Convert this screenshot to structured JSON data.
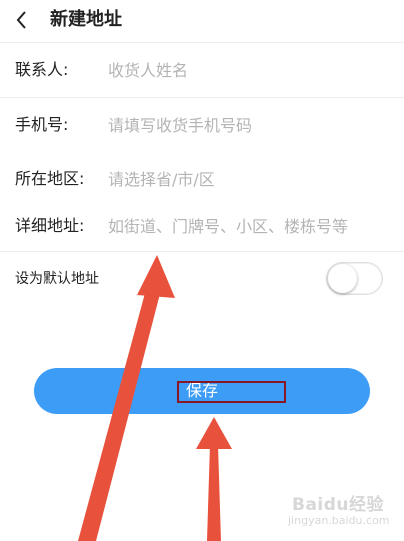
{
  "header": {
    "title": "新建地址",
    "back_icon": "chevron-left-icon"
  },
  "form": {
    "contact": {
      "label": "联系人:",
      "placeholder": "收货人姓名",
      "value": ""
    },
    "phone": {
      "label": "手机号:",
      "placeholder": "请填写收货手机号码",
      "value": ""
    },
    "region": {
      "label": "所在地区:",
      "placeholder": "请选择省/市/区",
      "value": ""
    },
    "address": {
      "label": "详细地址:",
      "placeholder": "如街道、门牌号、小区、楼栋号等",
      "value": ""
    }
  },
  "default_address": {
    "label": "设为默认地址",
    "enabled": false
  },
  "save": {
    "label": "保存"
  },
  "colors": {
    "accent": "#3d9cf5",
    "annotation_arrow": "#e8523c",
    "annotation_box": "#8a1626"
  },
  "watermark": {
    "brand": "Baidu经验",
    "sub": "jingyan.baidu.com"
  }
}
